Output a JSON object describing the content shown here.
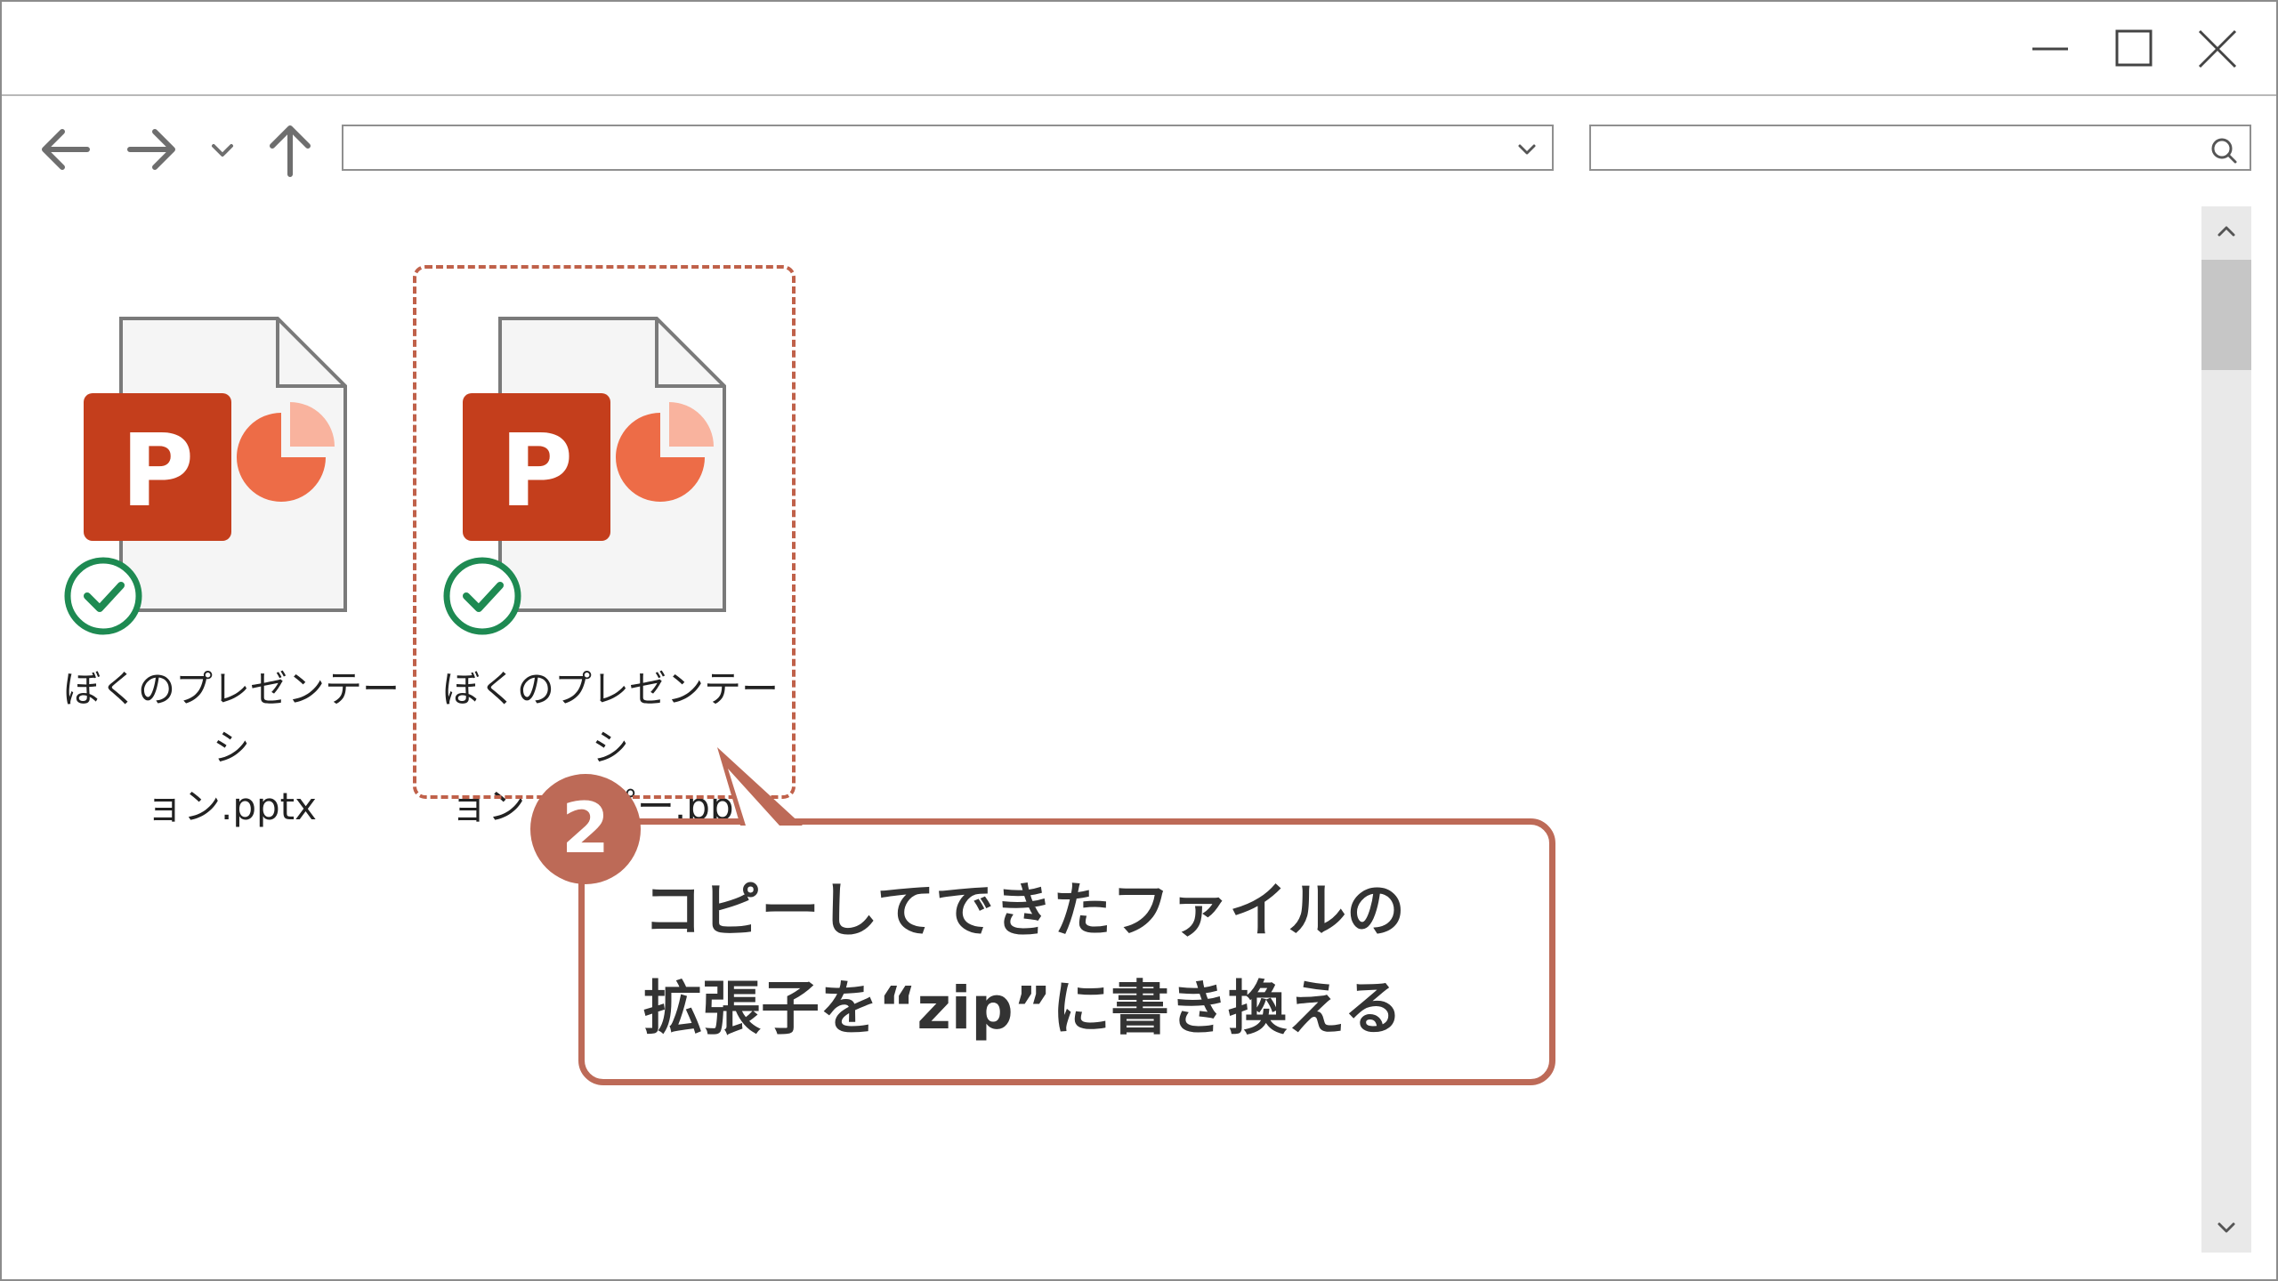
{
  "window": {
    "minimize_icon": "minimize-icon",
    "maximize_icon": "maximize-icon",
    "close_icon": "close-icon"
  },
  "toolbar": {
    "back_icon": "arrow-left-icon",
    "forward_icon": "arrow-right-icon",
    "recent_icon": "chevron-down-icon",
    "up_icon": "arrow-up-icon",
    "address_value": "",
    "search_placeholder": ""
  },
  "files": [
    {
      "name": "ぼくのプレゼンテーシ\nョン.pptx",
      "icon": "powerpoint-file-icon",
      "status": "synced-check-icon"
    },
    {
      "name": "ぼくのプレゼンテーシ\nョン - コピー.pptx",
      "icon": "powerpoint-file-icon",
      "status": "synced-check-icon"
    }
  ],
  "callout": {
    "step": "2",
    "line1": "コピーしてできたファイルの",
    "line2": "拡張子を“zip”に書き換える"
  },
  "colors": {
    "accent": "#bd6a57",
    "ppt_red": "#c43e1c",
    "ppt_orange": "#ed6c47",
    "check_green": "#1e8a52"
  }
}
